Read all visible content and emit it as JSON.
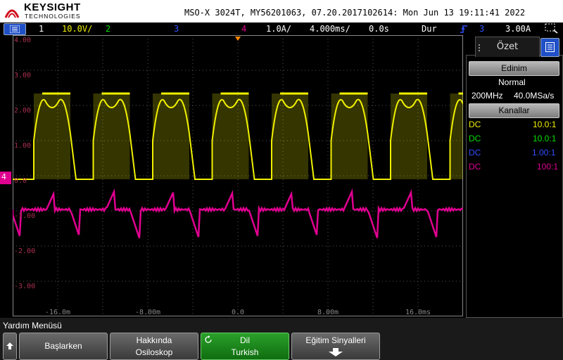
{
  "header": {
    "brand": "KEYSIGHT",
    "brand_sub": "TECHNOLOGIES",
    "title": "MSO-X 3024T, MY56201063, 07.20.2017102614: Mon Jun 13 19:11:41 2022"
  },
  "status": {
    "ch1_num": "1",
    "ch1_scale": "10.0V/",
    "ch2_num": "2",
    "ch3_num": "3",
    "ch4_num": "4",
    "ch4_scale": "1.0A/",
    "timebase": "4.000ms/",
    "delay": "0.0s",
    "mode": "Dur",
    "trig_src": "3",
    "trig_level": "3.00A"
  },
  "colors": {
    "ch1": "#f0f000",
    "ch2": "#00e000",
    "ch3": "#3050ff",
    "ch4": "#e00090",
    "trigger": "#ff8800",
    "accent": "#2050c8"
  },
  "grid": {
    "y_labels": [
      "4.00",
      "3.00",
      "2.00",
      "1.00",
      "0.0",
      "-1.00",
      "-2.00",
      "-3.00"
    ],
    "x_labels": [
      "-16.0m",
      "-8.00m",
      "0.0",
      "8.00m",
      "16.0ms"
    ],
    "ch_marker": "4"
  },
  "sidebar": {
    "tab": "Özet",
    "acq_button": "Edinim",
    "acq_mode": "Normal",
    "bandwidth": "200MHz",
    "sample_rate": "40.0MSa/s",
    "channels_button": "Kanallar",
    "channels": [
      {
        "coupling": "DC",
        "probe": "10.0:1"
      },
      {
        "coupling": "DC",
        "probe": "10.0:1"
      },
      {
        "coupling": "DC",
        "probe": "1.00:1"
      },
      {
        "coupling": "DC",
        "probe": "100:1"
      }
    ]
  },
  "softkeys": {
    "menu_title": "Yardım Menüsü",
    "key1": "Başlarken",
    "key2_l1": "Hakkında",
    "key2_l2": "Osiloskop",
    "key3_l1": "Dil",
    "key3_l2": "Turkish",
    "key4": "Eğitim Sinyalleri"
  }
}
